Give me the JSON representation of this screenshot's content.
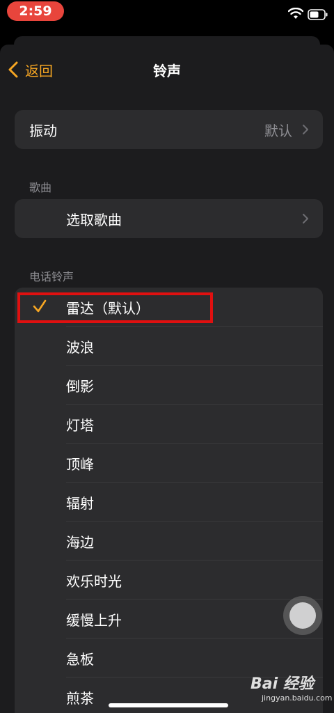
{
  "status_bar": {
    "time": "2:59"
  },
  "nav": {
    "back_label": "返回",
    "title": "铃声"
  },
  "vibration": {
    "label": "振动",
    "value": "默认"
  },
  "songs": {
    "header": "歌曲",
    "pick_label": "选取歌曲"
  },
  "ringtones": {
    "header": "电话铃声",
    "items": [
      {
        "label": "雷达（默认）",
        "selected": true
      },
      {
        "label": "波浪"
      },
      {
        "label": "倒影"
      },
      {
        "label": "灯塔"
      },
      {
        "label": "顶峰"
      },
      {
        "label": "辐射"
      },
      {
        "label": "海边"
      },
      {
        "label": "欢乐时光"
      },
      {
        "label": "缓慢上升"
      },
      {
        "label": "急板"
      },
      {
        "label": "煎茶"
      }
    ]
  },
  "watermark": {
    "logo": "Bai 经验",
    "url": "jingyan.baidu.com"
  },
  "colors": {
    "accent": "#f6a623",
    "background": "#1c1c1e",
    "cell": "#2c2c2e",
    "highlight": "#e01010"
  }
}
